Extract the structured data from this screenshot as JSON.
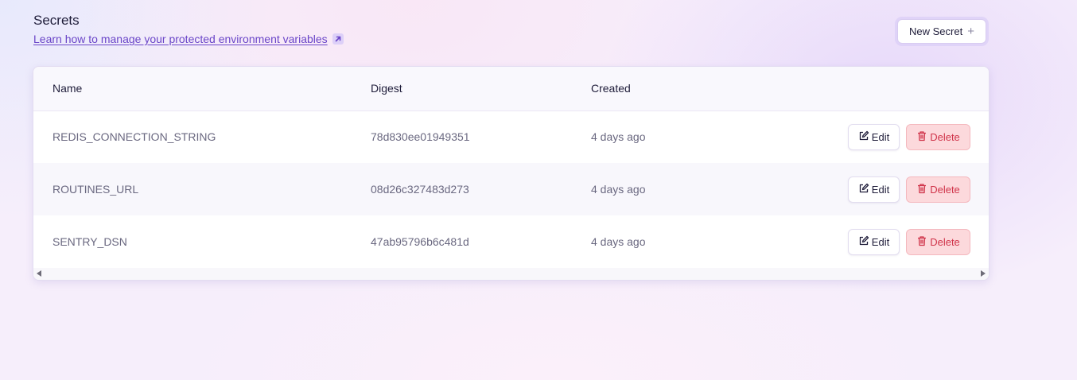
{
  "header": {
    "title": "Secrets",
    "learn_link": "Learn how to manage your protected environment variables",
    "learn_link_icon": "external-arrow-icon"
  },
  "actions": {
    "new_secret_label": "New Secret",
    "new_secret_icon": "plus-icon"
  },
  "table": {
    "columns": [
      "Name",
      "Digest",
      "Created"
    ],
    "rows": [
      {
        "name": "REDIS_CONNECTION_STRING",
        "digest": "78d830ee01949351",
        "created": "4 days ago"
      },
      {
        "name": "ROUTINES_URL",
        "digest": "08d26c327483d273",
        "created": "4 days ago"
      },
      {
        "name": "SENTRY_DSN",
        "digest": "47ab95796b6c481d",
        "created": "4 days ago"
      }
    ],
    "edit_label": "Edit",
    "delete_label": "Delete",
    "edit_icon": "pencil-square-icon",
    "delete_icon": "trash-icon"
  },
  "colors": {
    "accent": "#6a45c8",
    "danger": "#d0344a",
    "danger_bg": "#fcd9dc"
  }
}
